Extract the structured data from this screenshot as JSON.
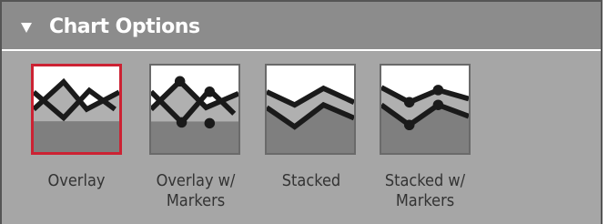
{
  "panel": {
    "title": "Chart Options",
    "collapse_icon": "caret-down-icon"
  },
  "options": [
    {
      "label": "Overlay",
      "selected": true
    },
    {
      "label": "Overlay w/\nMarkers",
      "selected": false
    },
    {
      "label": "Stacked",
      "selected": false
    },
    {
      "label": "Stacked w/\nMarkers",
      "selected": false
    }
  ],
  "colors": {
    "selection": "#cc2233",
    "header_bg": "#8c8c8c",
    "panel_bg": "#a6a6a6"
  }
}
